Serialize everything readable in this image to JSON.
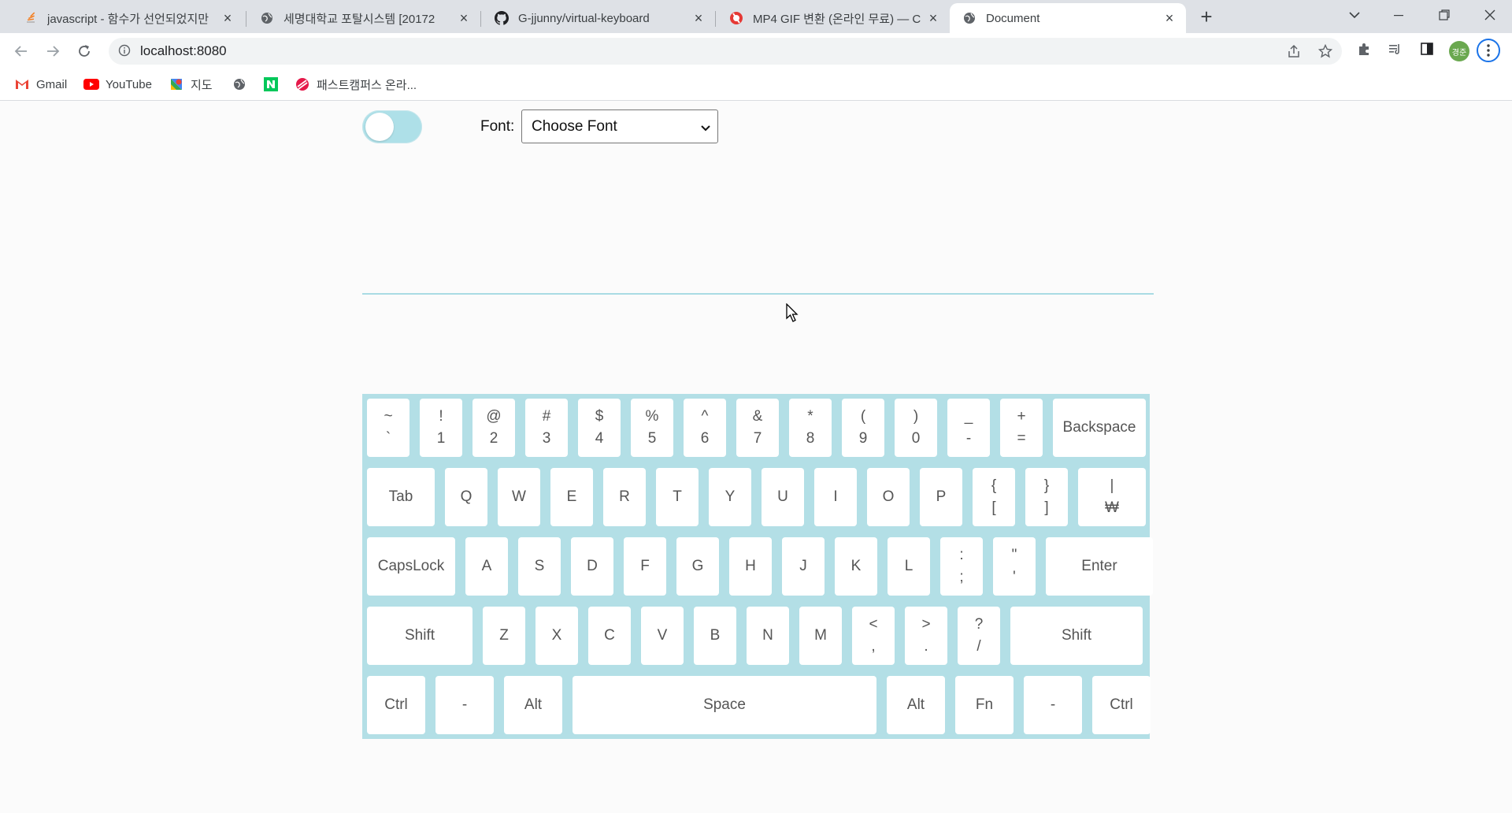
{
  "browser": {
    "tabs": [
      {
        "title": "javascript - 함수가 선언되었지만",
        "icon": "stackoverflow-icon",
        "active": false
      },
      {
        "title": "세명대학교 포탈시스템 [20172",
        "icon": "globe-icon",
        "active": false
      },
      {
        "title": "G-jjunny/virtual-keyboard",
        "icon": "github-icon",
        "active": false
      },
      {
        "title": "MP4 GIF 변환 (온라인 무료) — C",
        "icon": "convertio-icon",
        "active": false
      },
      {
        "title": "Document",
        "icon": "globe-icon",
        "active": true
      }
    ],
    "url": "localhost:8080",
    "avatar_initials": "경준",
    "bookmarks": [
      {
        "label": "Gmail",
        "icon": "gmail-icon"
      },
      {
        "label": "YouTube",
        "icon": "youtube-icon"
      },
      {
        "label": "지도",
        "icon": "maps-icon"
      },
      {
        "label": "",
        "icon": "globe-icon"
      },
      {
        "label": "",
        "icon": "naver-icon"
      },
      {
        "label": "패스트캠퍼스 온라...",
        "icon": "fastcampus-icon"
      }
    ]
  },
  "page": {
    "theme_toggle": {
      "on": false
    },
    "font_label": "Font:",
    "font_select": {
      "selected": "Choose Font"
    },
    "text_input_value": ""
  },
  "keyboard": {
    "rows": [
      [
        {
          "top": "~",
          "bottom": "`"
        },
        {
          "top": "!",
          "bottom": "1"
        },
        {
          "top": "@",
          "bottom": "2"
        },
        {
          "top": "#",
          "bottom": "3"
        },
        {
          "top": "$",
          "bottom": "4"
        },
        {
          "top": "%",
          "bottom": "5"
        },
        {
          "top": "^",
          "bottom": "6"
        },
        {
          "top": "&",
          "bottom": "7"
        },
        {
          "top": "*",
          "bottom": "8"
        },
        {
          "top": "(",
          "bottom": "9"
        },
        {
          "top": ")",
          "bottom": "0"
        },
        {
          "top": "_",
          "bottom": "-"
        },
        {
          "top": "+",
          "bottom": "="
        },
        {
          "label": "Backspace"
        }
      ],
      [
        {
          "label": "Tab"
        },
        {
          "label": "Q"
        },
        {
          "label": "W"
        },
        {
          "label": "E"
        },
        {
          "label": "R"
        },
        {
          "label": "T"
        },
        {
          "label": "Y"
        },
        {
          "label": "U"
        },
        {
          "label": "I"
        },
        {
          "label": "O"
        },
        {
          "label": "P"
        },
        {
          "top": "{",
          "bottom": "["
        },
        {
          "top": "}",
          "bottom": "]"
        },
        {
          "top": "|",
          "bottom": "₩"
        }
      ],
      [
        {
          "label": "CapsLock"
        },
        {
          "label": "A"
        },
        {
          "label": "S"
        },
        {
          "label": "D"
        },
        {
          "label": "F"
        },
        {
          "label": "G"
        },
        {
          "label": "H"
        },
        {
          "label": "J"
        },
        {
          "label": "K"
        },
        {
          "label": "L"
        },
        {
          "top": ":",
          "bottom": ";"
        },
        {
          "top": "\"",
          "bottom": "'"
        },
        {
          "label": "Enter"
        }
      ],
      [
        {
          "label": "Shift"
        },
        {
          "label": "Z"
        },
        {
          "label": "X"
        },
        {
          "label": "C"
        },
        {
          "label": "V"
        },
        {
          "label": "B"
        },
        {
          "label": "N"
        },
        {
          "label": "M"
        },
        {
          "top": "<",
          "bottom": ","
        },
        {
          "top": ">",
          "bottom": "."
        },
        {
          "top": "?",
          "bottom": "/"
        },
        {
          "label": "Shift"
        }
      ],
      [
        {
          "label": "Ctrl"
        },
        {
          "label": "-"
        },
        {
          "label": "Alt"
        },
        {
          "label": "Space"
        },
        {
          "label": "Alt"
        },
        {
          "label": "Fn"
        },
        {
          "label": "-"
        },
        {
          "label": "Ctrl"
        }
      ]
    ]
  }
}
